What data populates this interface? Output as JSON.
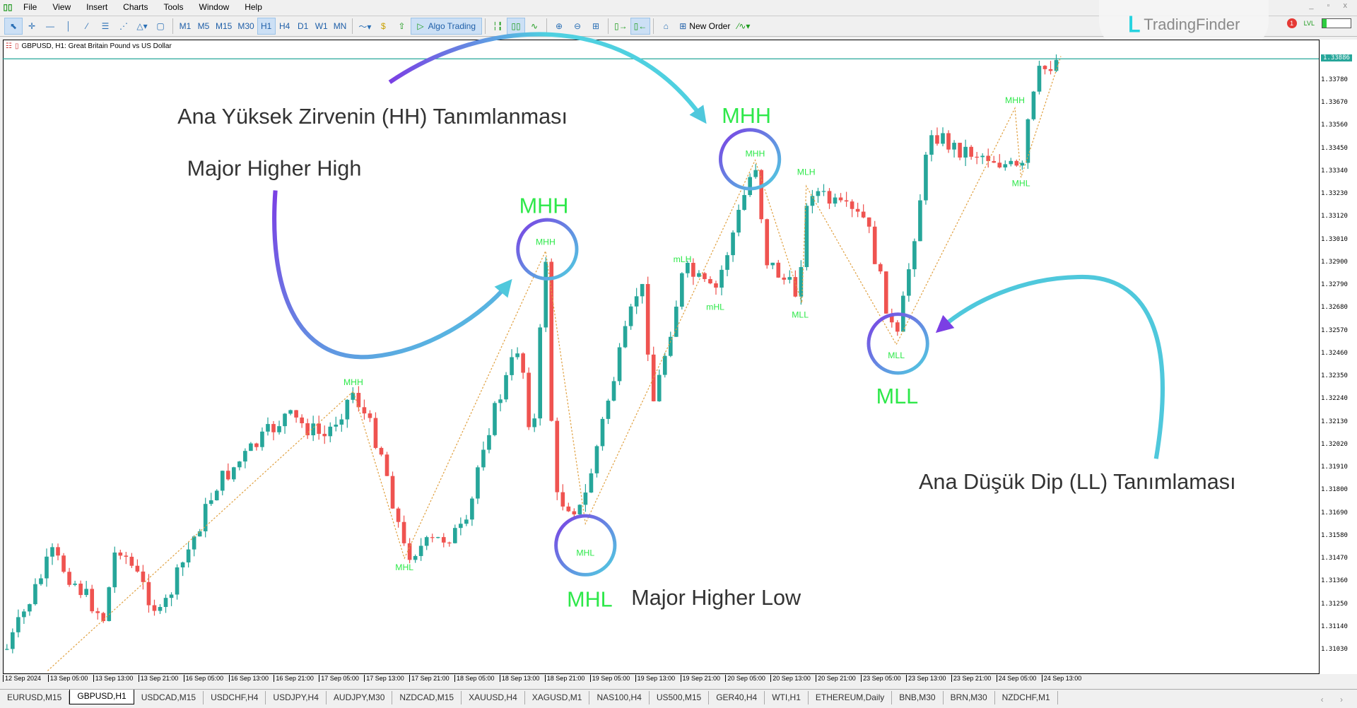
{
  "menu": {
    "items": [
      "File",
      "View",
      "Insert",
      "Charts",
      "Tools",
      "Window",
      "Help"
    ]
  },
  "window_controls": "_ ▫ x",
  "toolbar": {
    "tools": [
      {
        "name": "cursor-icon",
        "glyph": "⬉",
        "on": true
      },
      {
        "name": "crosshair-icon",
        "glyph": "✛"
      },
      {
        "name": "horizontal-line-icon",
        "glyph": "—"
      },
      {
        "name": "vertical-line-icon",
        "glyph": "│"
      },
      {
        "name": "trendline-icon",
        "glyph": "⁄"
      },
      {
        "name": "channel-icon",
        "glyph": "☰"
      },
      {
        "name": "fibonacci-icon",
        "glyph": "⋰"
      },
      {
        "name": "shapes-icon",
        "glyph": "△▾"
      },
      {
        "name": "rectangle-icon",
        "glyph": "▢"
      }
    ],
    "timeframes": [
      "M1",
      "M5",
      "M15",
      "M30",
      "H1",
      "H4",
      "D1",
      "W1",
      "MN"
    ],
    "active_timeframe": "H1",
    "algo_trading_label": "Algo Trading",
    "new_order_label": "New Order"
  },
  "brand": {
    "name": "TradingFinder"
  },
  "status": {
    "lvl_label": "LVL",
    "notifications": "1",
    "battery_level_percent": 15
  },
  "chart": {
    "title": "GBPUSD, H1:  Great Britain Pound vs US Dollar",
    "current_price": "1.33886",
    "price_ticks": [
      "1.33780",
      "1.33670",
      "1.33560",
      "1.33450",
      "1.33340",
      "1.33230",
      "1.33120",
      "1.33010",
      "1.32900",
      "1.32790",
      "1.32680",
      "1.32570",
      "1.32460",
      "1.32350",
      "1.32240",
      "1.32130",
      "1.32020",
      "1.31910",
      "1.31800",
      "1.31690",
      "1.31580",
      "1.31470",
      "1.31360",
      "1.31250",
      "1.31140",
      "1.31030"
    ],
    "time_ticks": [
      "12 Sep 2024",
      "13 Sep 05:00",
      "13 Sep 13:00",
      "13 Sep 21:00",
      "16 Sep 05:00",
      "16 Sep 13:00",
      "16 Sep 21:00",
      "17 Sep 05:00",
      "17 Sep 13:00",
      "17 Sep 21:00",
      "18 Sep 05:00",
      "18 Sep 13:00",
      "18 Sep 21:00",
      "19 Sep 05:00",
      "19 Sep 13:00",
      "19 Sep 21:00",
      "20 Sep 05:00",
      "20 Sep 13:00",
      "20 Sep 21:00",
      "23 Sep 05:00",
      "23 Sep 13:00",
      "23 Sep 21:00",
      "24 Sep 05:00",
      "24 Sep 13:00"
    ],
    "colors": {
      "bull": "#26a69a",
      "bear": "#ef5350",
      "label_green": "#2ee84a",
      "zigzag": "#e0a040",
      "price_line": "#26a69a"
    },
    "swing_labels": [
      "MHH",
      "MHL",
      "MHH",
      "MHL",
      "mLH",
      "mHL",
      "MHH",
      "MLH",
      "MLL",
      "MLL",
      "MHH",
      "MHL"
    ],
    "big_labels": [
      "MHH",
      "MHH",
      "MHL",
      "MLL"
    ],
    "annotations": {
      "hh_turkish": "Ana Yüksek Zirvenin (HH) Tanımlanması",
      "hh_english": "Major Higher High",
      "hl_english": "Major Higher Low",
      "ll_turkish": "Ana Düşük Dip (LL) Tanımlaması"
    }
  },
  "tabs": {
    "items": [
      "EURUSD,M15",
      "GBPUSD,H1",
      "USDCAD,M15",
      "USDCHF,H4",
      "USDJPY,H4",
      "AUDJPY,M30",
      "NZDCAD,M15",
      "XAUUSD,H4",
      "XAGUSD,M1",
      "NAS100,H4",
      "US500,M15",
      "GER40,H4",
      "WTI,H1",
      "ETHEREUM,Daily",
      "BNB,M30",
      "BRN,M30",
      "NZDCHF,M1"
    ],
    "active": "GBPUSD,H1"
  }
}
